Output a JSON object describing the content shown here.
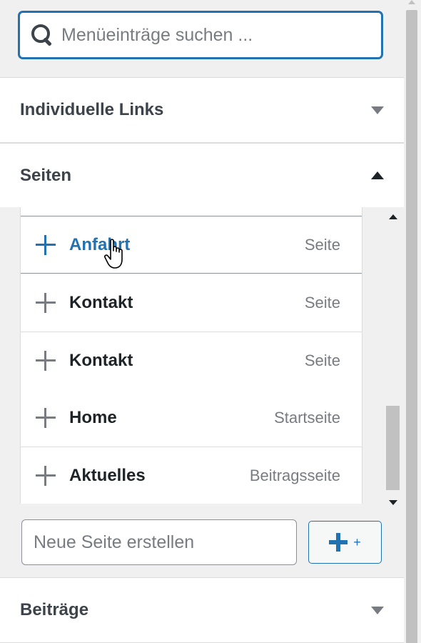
{
  "search": {
    "placeholder": "Menüeinträge suchen ..."
  },
  "sections": {
    "custom_links": {
      "title": "Individuelle Links"
    },
    "pages": {
      "title": "Seiten"
    },
    "posts": {
      "title": "Beiträge"
    }
  },
  "pages_list": [
    {
      "title": "Anfahrt",
      "type": "Seite"
    },
    {
      "title": "Kontakt",
      "type": "Seite"
    },
    {
      "title": "Kontakt",
      "type": "Seite"
    },
    {
      "title": "Home",
      "type": "Startseite"
    },
    {
      "title": "Aktuelles",
      "type": "Beitragsseite"
    }
  ],
  "new_page": {
    "placeholder": "Neue Seite erstellen",
    "add_label": "+"
  },
  "colors": {
    "accent": "#2271b1",
    "muted": "#787c82",
    "background": "#f0f0f1"
  }
}
